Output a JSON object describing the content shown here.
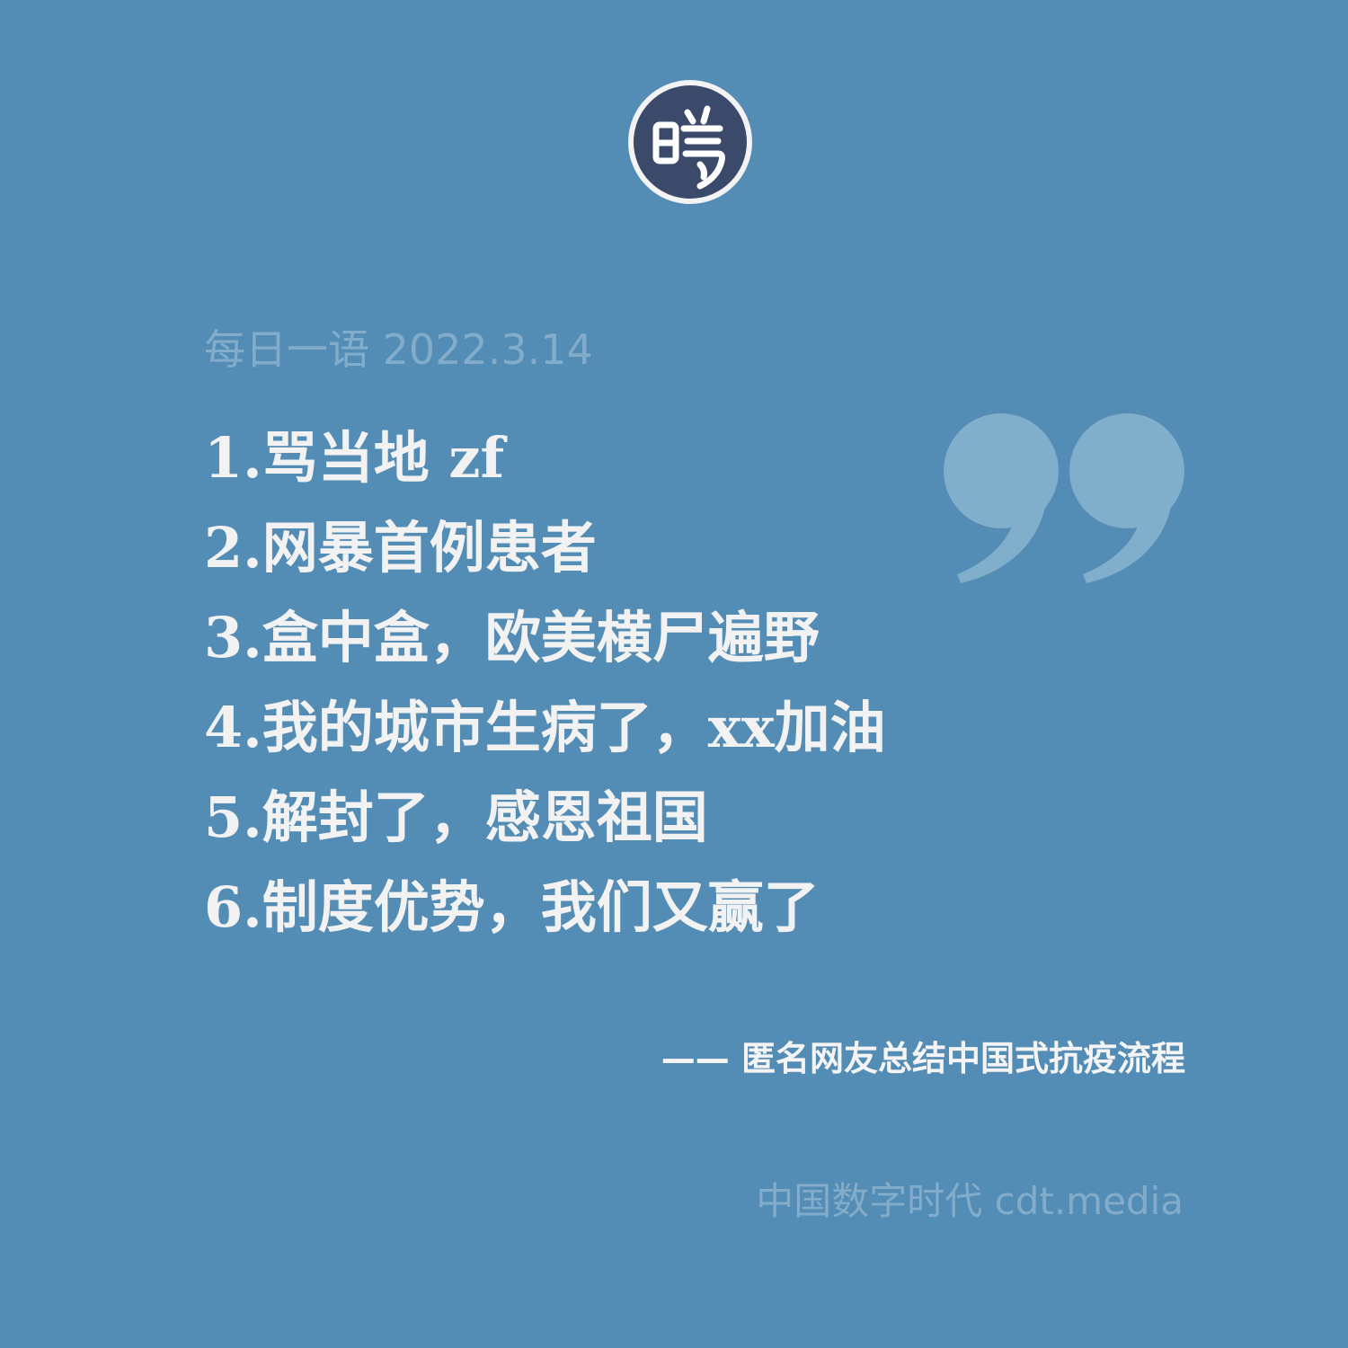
{
  "logo": {
    "icon": "cdt-seal-icon",
    "colors": {
      "ring": "#f3f3f3",
      "fill": "#3b4a6b",
      "glyph": "#ffffff"
    }
  },
  "header": {
    "text": "每日一语 2022.3.14"
  },
  "quote_icon": "closing-quote-icon",
  "lines": [
    "1.骂当地 zf",
    "2.网暴首例患者",
    "3.盒中盒，欧美横尸遍野",
    "4.我的城市生病了，xx加油",
    "5.解封了，感恩祖国",
    "6.制度优势，我们又赢了"
  ],
  "attribution": "—— 匿名网友总结中国式抗疫流程",
  "footer": "中国数字时代 cdt.media",
  "colors": {
    "background": "#538cb4",
    "primary_text": "#f2f2f2",
    "muted_text": "#82acca",
    "quote_mark": "#80aecb"
  }
}
